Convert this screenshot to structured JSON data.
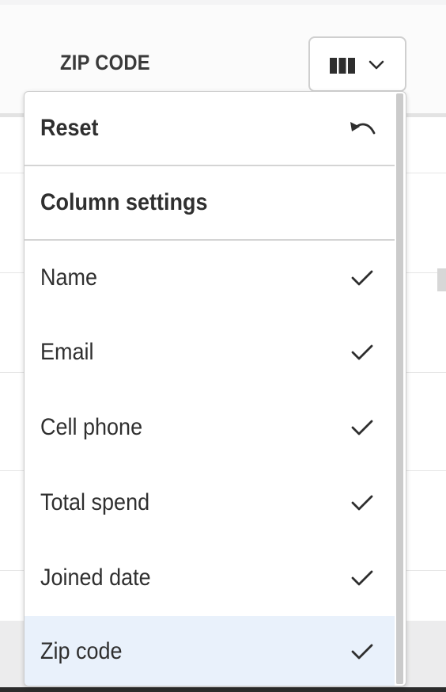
{
  "table": {
    "column_header": "ZIP CODE"
  },
  "columns_button": {
    "icon": "columns-icon",
    "chevron_icon": "chevron-down-icon"
  },
  "menu": {
    "reset": {
      "label": "Reset",
      "icon": "undo-icon"
    },
    "section_title": "Column settings",
    "items": [
      {
        "label": "Name",
        "checked": true
      },
      {
        "label": "Email",
        "checked": true
      },
      {
        "label": "Cell phone",
        "checked": true
      },
      {
        "label": "Total spend",
        "checked": true
      },
      {
        "label": "Joined date",
        "checked": true
      },
      {
        "label": "Zip code",
        "checked": true,
        "highlighted": true
      }
    ]
  },
  "colors": {
    "highlight": "#e9f1fb",
    "text": "#2f2f2f",
    "border": "#cdcdcd"
  }
}
